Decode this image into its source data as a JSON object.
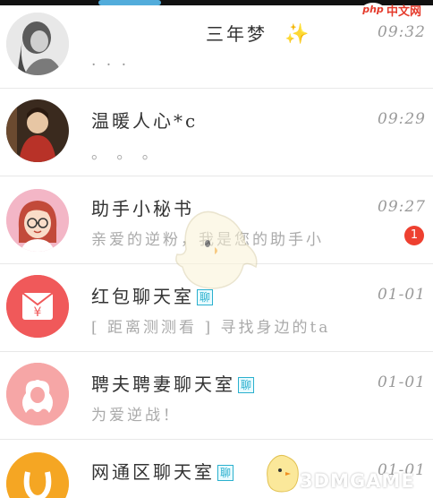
{
  "chats": [
    {
      "name": "三年梦",
      "sparkle": true,
      "time": "09:32",
      "preview": ". . ."
    },
    {
      "name": "温暖人心*c",
      "time": "09:29",
      "preview": "。 。 。"
    },
    {
      "name": "助手小秘书",
      "time": "09:27",
      "preview": "亲爱的逆粉，我是您的助手小",
      "unread_count": "1"
    },
    {
      "name": "红包聊天室",
      "tag": "聊",
      "time": "01-01",
      "preview": "[ 距离测测看 ] 寻找身边的ta"
    },
    {
      "name": "聘夫聘妻聊天室",
      "tag": "聊",
      "time": "01-01",
      "preview": "为爱逆战！"
    },
    {
      "name": "网通区聊天室",
      "tag": "聊",
      "time": "01-01",
      "preview": ""
    }
  ],
  "watermarks": {
    "php_logo": "php",
    "php_text": "中文网",
    "brand_3dm": "3DMGAME"
  },
  "colors": {
    "accent_blue": "#2ab0ce",
    "unread_red": "#ee4030",
    "hongbao_red": "#f0595a",
    "pink": "#f6a6a6",
    "orange": "#f5a623"
  },
  "icons": [
    "girl-avatar-icon",
    "red-envelope-icon",
    "couple-silhouette-icon",
    "unicom-logo-icon",
    "sparkle-icon",
    "bird-mascot-icon"
  ]
}
